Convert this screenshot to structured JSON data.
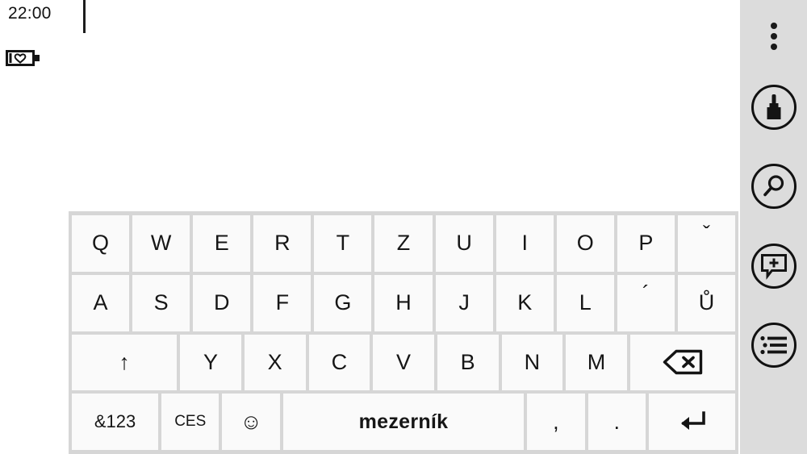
{
  "status_bar": {
    "clock": "22:00",
    "battery_icon": "battery-saver-icon"
  },
  "note_area": {
    "caret": "text-caret",
    "content": ""
  },
  "sidebar": {
    "background_color": "#dcdcdc",
    "items": [
      {
        "name": "overflow-menu",
        "icon": "three-dots-vertical-icon",
        "label": "More options"
      },
      {
        "name": "pen-tool",
        "icon": "paintbrush-icon",
        "label": "Drawing tool"
      },
      {
        "name": "search",
        "icon": "magnifier-icon",
        "label": "Search"
      },
      {
        "name": "add-note",
        "icon": "speech-bubble-plus-icon",
        "label": "New note"
      },
      {
        "name": "list-view",
        "icon": "bulleted-list-icon",
        "label": "Notes list"
      }
    ]
  },
  "keyboard": {
    "layout_name": "QWERTZ",
    "language_key": "CES",
    "key_bg": "#fafafa",
    "frame_bg": "#d6d6d6",
    "rows": [
      {
        "name": "row-1",
        "keys": [
          {
            "label": "Q",
            "name": "key-q"
          },
          {
            "label": "W",
            "name": "key-w"
          },
          {
            "label": "E",
            "name": "key-e"
          },
          {
            "label": "R",
            "name": "key-r"
          },
          {
            "label": "T",
            "name": "key-t"
          },
          {
            "label": "Z",
            "name": "key-z"
          },
          {
            "label": "U",
            "name": "key-u"
          },
          {
            "label": "I",
            "name": "key-i"
          },
          {
            "label": "O",
            "name": "key-o"
          },
          {
            "label": "P",
            "name": "key-p"
          },
          {
            "label": "ˇ",
            "name": "key-caron"
          }
        ]
      },
      {
        "name": "row-2",
        "keys": [
          {
            "label": "A",
            "name": "key-a"
          },
          {
            "label": "S",
            "name": "key-s"
          },
          {
            "label": "D",
            "name": "key-d"
          },
          {
            "label": "F",
            "name": "key-f"
          },
          {
            "label": "G",
            "name": "key-g"
          },
          {
            "label": "H",
            "name": "key-h"
          },
          {
            "label": "J",
            "name": "key-j"
          },
          {
            "label": "K",
            "name": "key-k"
          },
          {
            "label": "L",
            "name": "key-l"
          },
          {
            "label": "´",
            "name": "key-acute"
          },
          {
            "label": "Ů",
            "name": "key-u-ring"
          }
        ]
      },
      {
        "name": "row-3",
        "keys": [
          {
            "label": "↑",
            "name": "key-shift"
          },
          {
            "label": "Y",
            "name": "key-y"
          },
          {
            "label": "X",
            "name": "key-x"
          },
          {
            "label": "C",
            "name": "key-c"
          },
          {
            "label": "V",
            "name": "key-v"
          },
          {
            "label": "B",
            "name": "key-b"
          },
          {
            "label": "N",
            "name": "key-n"
          },
          {
            "label": "M",
            "name": "key-m"
          },
          {
            "label": "",
            "name": "key-backspace"
          }
        ]
      },
      {
        "name": "row-4",
        "keys": [
          {
            "label": "&123",
            "name": "key-symbols"
          },
          {
            "label": "CES",
            "name": "key-language"
          },
          {
            "label": "☺",
            "name": "key-emoji"
          },
          {
            "label": "mezerník",
            "name": "key-space"
          },
          {
            "label": ",",
            "name": "key-comma"
          },
          {
            "label": ".",
            "name": "key-period"
          },
          {
            "label": "↵",
            "name": "key-enter"
          }
        ]
      }
    ]
  }
}
